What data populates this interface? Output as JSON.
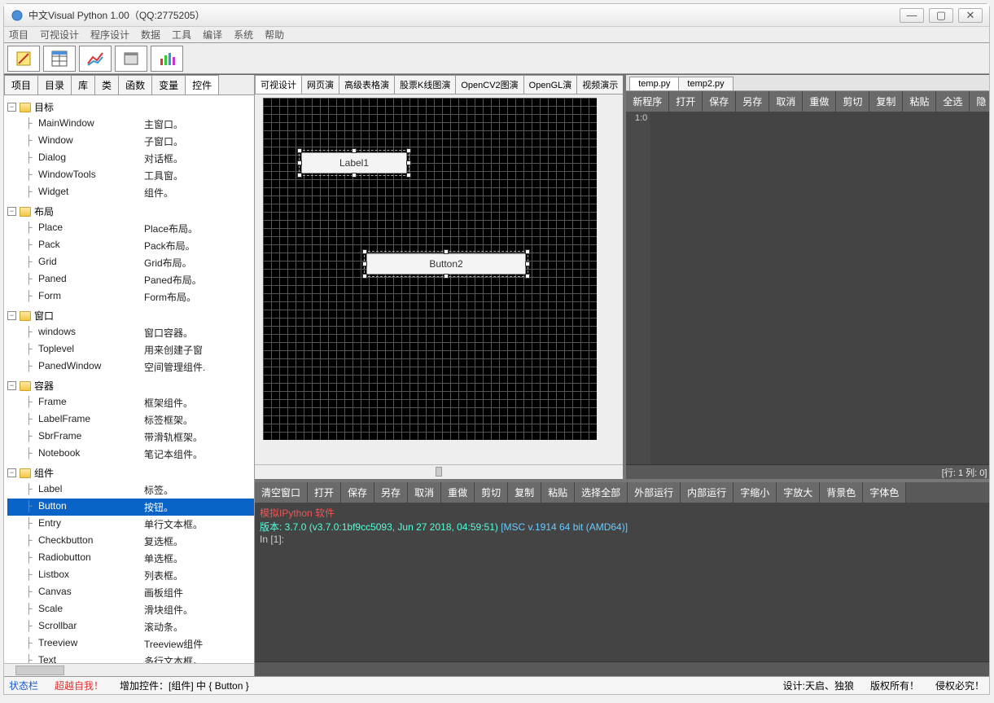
{
  "titlebar": {
    "title": "中文Visual Python 1.00（QQ:2775205）"
  },
  "menu": [
    "项目",
    "可视设计",
    "程序设计",
    "数据",
    "工具",
    "编译",
    "系统",
    "帮助"
  ],
  "leftTabs": [
    "项目",
    "目录",
    "库",
    "类",
    "函数",
    "变量",
    "控件"
  ],
  "leftTabActive": 6,
  "tree": [
    {
      "group": "目标",
      "items": [
        {
          "n": "MainWindow",
          "d": "主窗口。"
        },
        {
          "n": "Window",
          "d": "子窗口。"
        },
        {
          "n": "Dialog",
          "d": "对话框。"
        },
        {
          "n": "WindowTools",
          "d": "工具窗。"
        },
        {
          "n": "Widget",
          "d": "组件。"
        }
      ]
    },
    {
      "group": "布局",
      "items": [
        {
          "n": "Place",
          "d": "Place布局。"
        },
        {
          "n": "Pack",
          "d": "Pack布局。"
        },
        {
          "n": "Grid",
          "d": "Grid布局。"
        },
        {
          "n": "Paned",
          "d": "Paned布局。"
        },
        {
          "n": "Form",
          "d": "Form布局。"
        }
      ]
    },
    {
      "group": "窗口",
      "items": [
        {
          "n": "windows",
          "d": "窗口容器。"
        },
        {
          "n": "Toplevel",
          "d": "用来创建子窗"
        },
        {
          "n": "PanedWindow",
          "d": "空间管理组件."
        }
      ]
    },
    {
      "group": "容器",
      "items": [
        {
          "n": "Frame",
          "d": "框架组件。"
        },
        {
          "n": "LabelFrame",
          "d": "标签框架。"
        },
        {
          "n": "SbrFrame",
          "d": "带滑轨框架。"
        },
        {
          "n": "Notebook",
          "d": "笔记本组件。"
        }
      ]
    },
    {
      "group": "组件",
      "items": [
        {
          "n": "Label",
          "d": "标签。"
        },
        {
          "n": "Button",
          "d": "按钮。",
          "sel": true
        },
        {
          "n": "Entry",
          "d": "单行文本框。"
        },
        {
          "n": "Checkbutton",
          "d": "复选框。"
        },
        {
          "n": "Radiobutton",
          "d": "单选框。"
        },
        {
          "n": "Listbox",
          "d": "列表框。"
        },
        {
          "n": "Canvas",
          "d": "画板组件"
        },
        {
          "n": "Scale",
          "d": "滑块组件。"
        },
        {
          "n": "Scrollbar",
          "d": "滚动条。"
        },
        {
          "n": "Treeview",
          "d": "Treeview组件"
        },
        {
          "n": "Text",
          "d": "多行文本框。"
        }
      ]
    }
  ],
  "designTabs": [
    "可视设计",
    "网页演",
    "高级表格演",
    "股票K线图演",
    "OpenCV2图演",
    "OpenGL演",
    "视频演示"
  ],
  "designTabActive": 0,
  "canvas": {
    "label1": "Label1",
    "button2": "Button2"
  },
  "codeTabs": [
    "temp.py",
    "temp2.py"
  ],
  "codeTabActive": 0,
  "codeToolbar": [
    "新程序",
    "打开",
    "保存",
    "另存",
    "取消",
    "重做",
    "剪切",
    "复制",
    "粘贴",
    "全选",
    "隐"
  ],
  "gutter": "1:0",
  "editorStatus": "[行: 1  列: 0]",
  "consoleToolbar": [
    "清空窗口",
    "打开",
    "保存",
    "另存",
    "取消",
    "重做",
    "剪切",
    "复制",
    "粘贴",
    "选择全部",
    "外部运行",
    "内部运行",
    "字缩小",
    "字放大",
    "背景色",
    "字体色"
  ],
  "console": {
    "l1a": "模拟",
    "l1b": "IPython  软件",
    "l2a": "版本: ",
    "l2b": "3.7.0 (v3.7.0:1bf9cc5093, Jun 27 2018, 04:59:51) ",
    "l2c": "[MSC v.1914 64 bit (AMD64)]",
    "l3": "In [1]:"
  },
  "status": {
    "label": "状态栏",
    "motto": "超越自我！",
    "action": "增加控件：[组件] 中 { Button }",
    "author": "设计:天启、独狼",
    "copy": "版权所有！",
    "right": "侵权必究！"
  }
}
